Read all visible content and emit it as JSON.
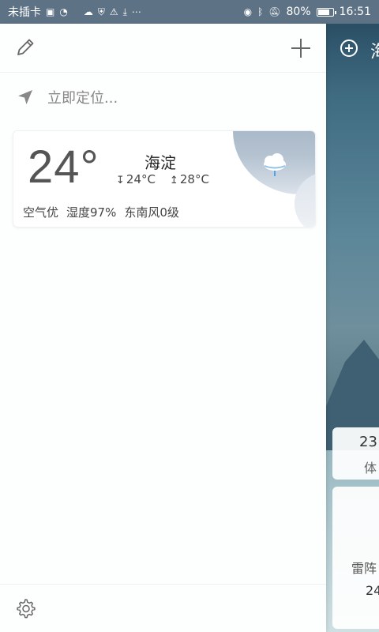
{
  "status_bar": {
    "carrier": "未插卡",
    "battery_percent_text": "80%",
    "battery_level": 0.8,
    "time": "16:51"
  },
  "drawer": {
    "location_prompt": "立即定位...",
    "city_card": {
      "temperature": "24°",
      "city": "海淀",
      "low": "24°C",
      "high": "28°C",
      "air_quality": "空气优",
      "humidity": "湿度97%",
      "wind": "东南风0级",
      "weather_icon": "rain-cloud-icon"
    }
  },
  "background_page": {
    "city_partial": "海",
    "card1_value": "23",
    "card1_label": "体",
    "card2_label": "雷阵",
    "card2_value": "24"
  },
  "icons": {
    "top_left": "edit-icon",
    "top_right": "add-icon",
    "locate": "location-arrow-icon",
    "settings": "gear-icon"
  },
  "colors": {
    "status_bar": "#5e7286",
    "text_muted": "#888888"
  }
}
